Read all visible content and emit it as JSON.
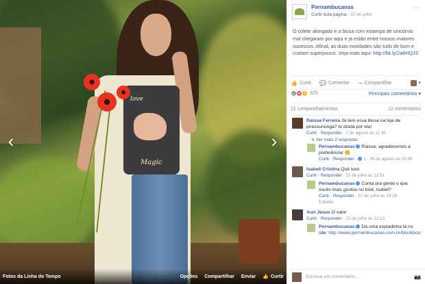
{
  "photo": {
    "album_label": "Fotos da Linha do Tempo",
    "tee_text_top": "love",
    "tee_text_bottom": "Magic",
    "actions": [
      {
        "label": "Opções"
      },
      {
        "label": "Compartilhar"
      },
      {
        "label": "Enviar"
      },
      {
        "label": "Curtir"
      }
    ]
  },
  "post": {
    "page_name": "Pernambucanas",
    "like_page": "Curtir esta página",
    "date": "22 de julho",
    "text": "O colete alongado e a blusa com estampa de unicórnio mal chegaram por aqui e já estão entre nossos maiores sucessos. Afinal, as duas novidades são tudo de bom e custam superpouco. Veja mais aqui: ",
    "url": "http://bit.ly/2a6HQJS",
    "actions": {
      "like": "Curtir",
      "comment": "Comentar",
      "share": "Compartilhar"
    },
    "reactions_count": "325",
    "reactions_filter": "Principais comentários",
    "shares": "21 compartilhamentos",
    "comments_count": "12 comentários"
  },
  "comments": [
    {
      "author": "Raissa Ferreira",
      "text": "Já tem essa blusa na loja de pirassununga? to doida por ela!",
      "meta_actions": "Curtir · Responder",
      "time": "2 de agosto às 11:46",
      "more_replies": "Ver mais 2 respostas",
      "reply": {
        "author": "Pernambucanas",
        "text": "Raissa, agradecemos a preferência! 😊",
        "meta_actions": "Curtir · Responder ·",
        "likes": "1",
        "time": "26 de agosto às 15:56"
      }
    },
    {
      "author": "Isabell Cristina",
      "text": "Quê luxo",
      "meta_actions": "Curtir · Responder",
      "time": "22 de julho às 12:51",
      "reply": {
        "author": "Pernambucanas",
        "text": "Conta pra gente o que vocês mais gostou no look, Isabel?",
        "meta_actions": "Curtir · Responder",
        "time": "27 de julho às 19:28",
        "edited": "Editado"
      }
    },
    {
      "author": "Auri Jesus",
      "text": "O valor",
      "meta_actions": "Curtir · Responder",
      "time": "22 de julho às 12:13",
      "reply": {
        "author": "Pernambucanas",
        "text": "Dá uma espiadinha lá no site: ",
        "url": "http://www.pernambucanas.com.br/blookboo"
      }
    }
  ],
  "comment_box": {
    "placeholder": "Escreva um comentário..."
  },
  "colors": {
    "link": "#365899",
    "gray": "#90949c"
  }
}
